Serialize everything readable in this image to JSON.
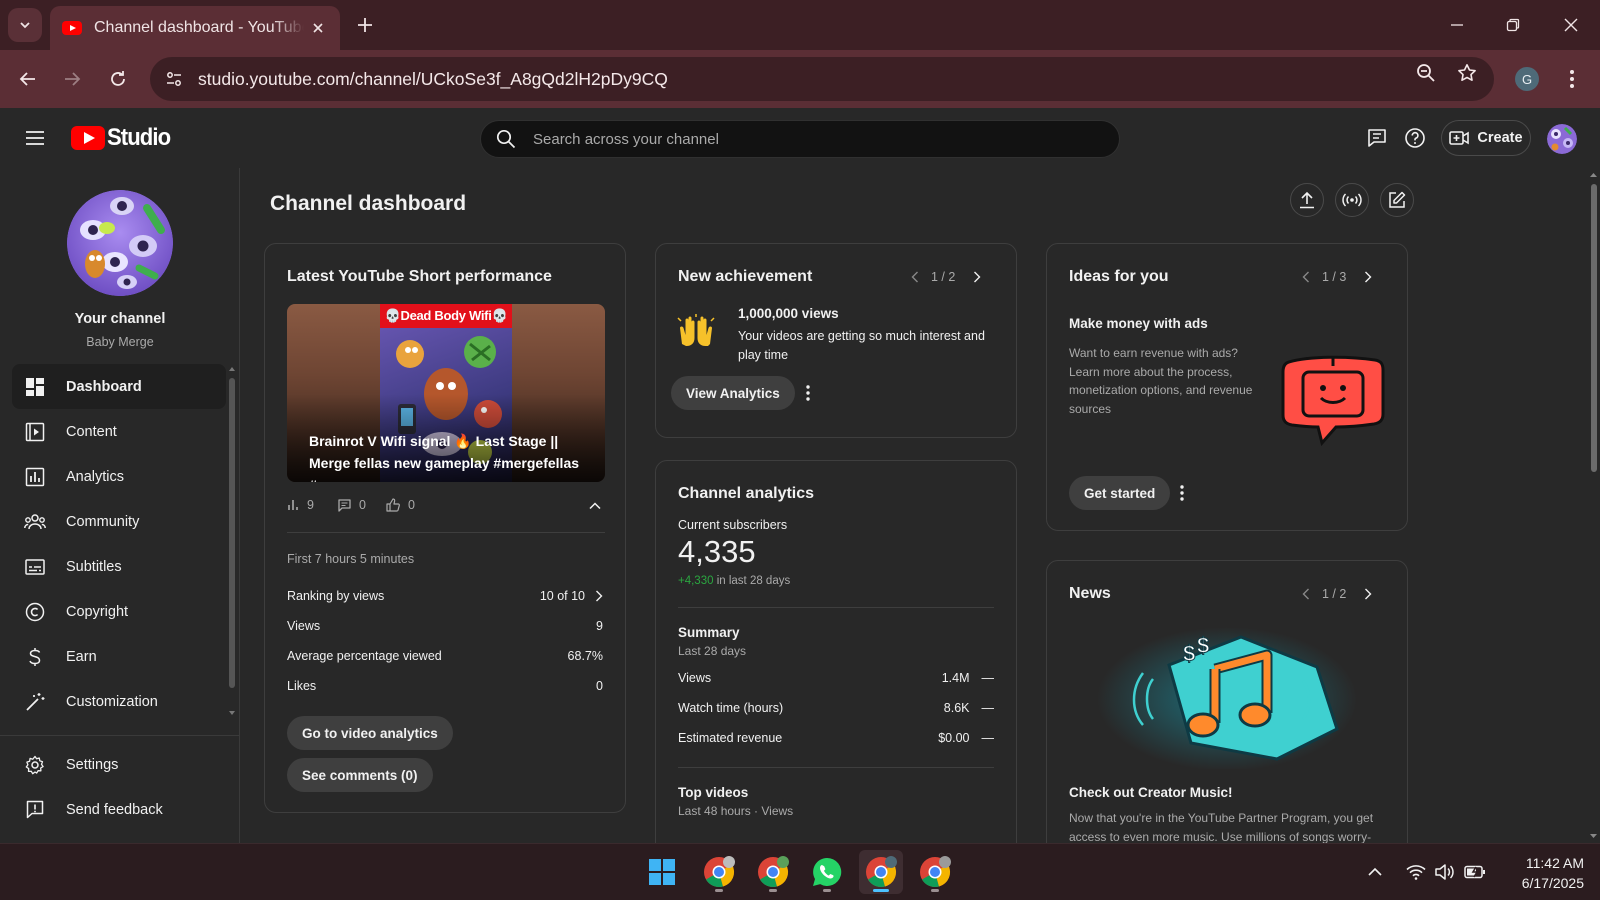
{
  "browser": {
    "tab_title": "Channel dashboard - YouTube Studio",
    "url": "studio.youtube.com/channel/UCkoSe3f_A8gQd2lH2pDy9CQ",
    "profile_initial": "G"
  },
  "header": {
    "logo_text": "Studio",
    "search_placeholder": "Search across your channel",
    "create_label": "Create"
  },
  "sidebar": {
    "your_channel": "Your channel",
    "channel_name": "Baby Merge",
    "items": [
      {
        "label": "Dashboard",
        "icon": "dashboard-icon",
        "active": true
      },
      {
        "label": "Content",
        "icon": "content-icon"
      },
      {
        "label": "Analytics",
        "icon": "analytics-icon"
      },
      {
        "label": "Community",
        "icon": "community-icon"
      },
      {
        "label": "Subtitles",
        "icon": "subtitles-icon"
      },
      {
        "label": "Copyright",
        "icon": "copyright-icon"
      },
      {
        "label": "Earn",
        "icon": "earn-icon"
      },
      {
        "label": "Customization",
        "icon": "customization-icon"
      }
    ],
    "bottom_items": [
      {
        "label": "Settings",
        "icon": "settings-icon"
      },
      {
        "label": "Send feedback",
        "icon": "feedback-icon"
      }
    ]
  },
  "main": {
    "page_title": "Channel dashboard",
    "short_card": {
      "title": "Latest YouTube Short performance",
      "thumb_banner": "💀Dead Body Wifi💀",
      "video_title": "Brainrot V Wifi signal 🔥 Last Stage || Merge fellas new gameplay #mergefellas #games",
      "views_count": "9",
      "comments_count": "0",
      "likes_count": "0",
      "period": "First 7 hours 5 minutes",
      "rows": [
        {
          "label": "Ranking by views",
          "value": "10 of 10"
        },
        {
          "label": "Views",
          "value": "9"
        },
        {
          "label": "Average percentage viewed",
          "value": "68.7%"
        },
        {
          "label": "Likes",
          "value": "0"
        }
      ],
      "analytics_btn": "Go to video analytics",
      "comments_btn": "See comments (0)"
    },
    "achievement_card": {
      "title": "New achievement",
      "pager": "1 / 2",
      "headline": "1,000,000 views",
      "body": "Your videos are getting so much interest and play time",
      "button": "View Analytics"
    },
    "analytics_card": {
      "title": "Channel analytics",
      "subs_label": "Current subscribers",
      "subs_value": "4,335",
      "subs_delta": "+4,330",
      "subs_delta_suffix": "in last 28 days",
      "summary_title": "Summary",
      "summary_period": "Last 28 days",
      "rows": [
        {
          "label": "Views",
          "value": "1.4M",
          "trend": "—"
        },
        {
          "label": "Watch time (hours)",
          "value": "8.6K",
          "trend": "—"
        },
        {
          "label": "Estimated revenue",
          "value": "$0.00",
          "trend": "—"
        }
      ],
      "top_title": "Top videos",
      "top_period": "Last 48 hours · Views"
    },
    "ideas_card": {
      "title": "Ideas for you",
      "pager": "1 / 3",
      "headline": "Make money with ads",
      "body": "Want to earn revenue with ads? Learn more about the process, monetization options, and revenue sources",
      "button": "Get started"
    },
    "news_card": {
      "title": "News",
      "pager": "1 / 2",
      "headline": "Check out Creator Music!",
      "body": "Now that you're in the YouTube Partner Program, you get access to even more music. Use millions of songs worry-free"
    }
  },
  "taskbar": {
    "time": "11:42 AM",
    "date": "6/17/2025"
  },
  "colors": {
    "accent_red": "#ff0000",
    "positive_green": "#2ba640"
  }
}
